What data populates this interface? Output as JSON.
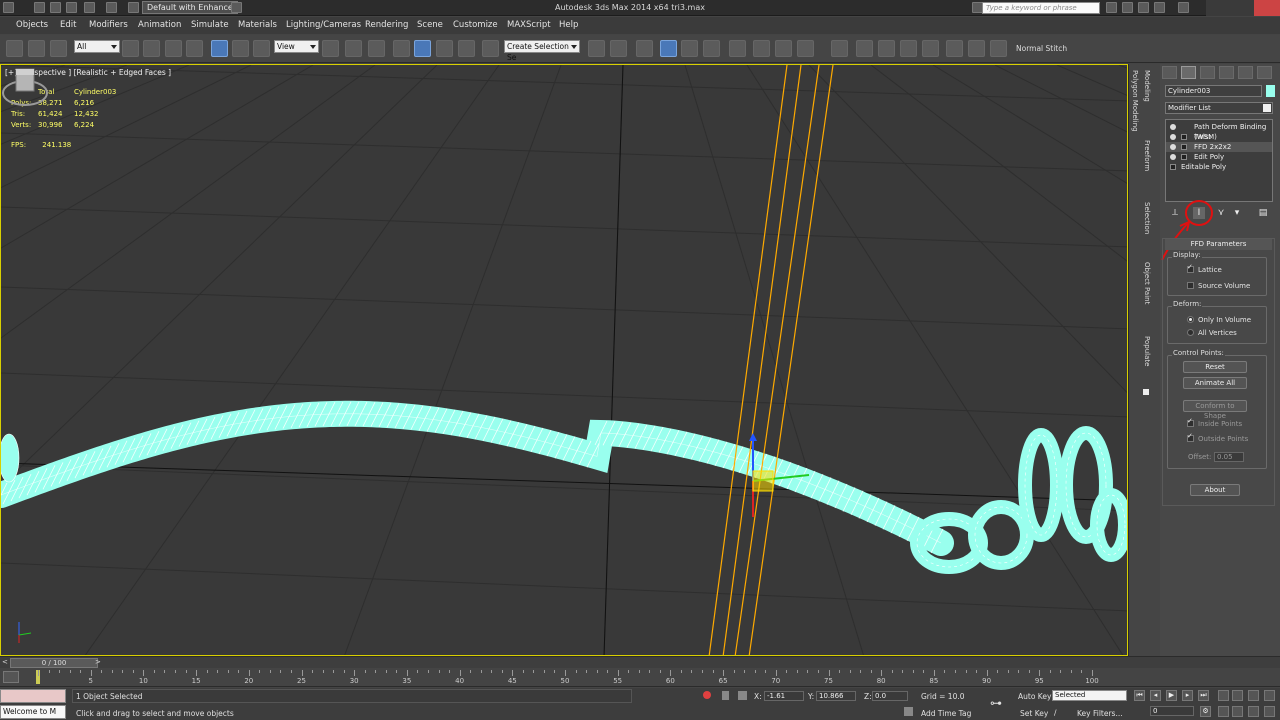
{
  "window": {
    "title": "Autodesk 3ds Max 2014 x64     tri3.max",
    "workspace": "Default with Enhance",
    "search_placeholder": "Type a keyword or phrase"
  },
  "menu": [
    "Objects",
    "Edit",
    "Modifiers",
    "Animation",
    "Simulate",
    "Materials",
    "Lighting/Cameras",
    "Rendering",
    "Scene",
    "Customize",
    "MAXScript",
    "Help"
  ],
  "toolbar": {
    "selection_filter": "All",
    "ref_coord": "View",
    "named_selection": "Create Selection Se",
    "normal_stitch": "Normal Stitch"
  },
  "viewport": {
    "label": "[+] [Perspective ] [Realistic + Edged Faces ]",
    "stats": {
      "col_total": "Total",
      "col_object": "Cylinder003",
      "rows": [
        {
          "label": "Polys:",
          "total": "38,271",
          "object": "6,216"
        },
        {
          "label": "Tris:",
          "total": "61,424",
          "object": "12,432"
        },
        {
          "label": "Verts:",
          "total": "30,996",
          "object": "6,224"
        }
      ],
      "fps_label": "FPS:",
      "fps_value": "241.138"
    },
    "object_color": "#99ffee",
    "gizmo_color": "#ffaa00"
  },
  "ribbon_tabs": [
    "Modeling",
    "Polygon Modeling",
    "Freeform",
    "Selection",
    "Object Paint",
    "Populate"
  ],
  "command_panel": {
    "object_name": "Cylinder003",
    "modifier_list": "Modifier List",
    "stack": [
      {
        "label": "Path Deform Binding (WSM)"
      },
      {
        "label": "Twist"
      },
      {
        "label": "FFD 2x2x2"
      },
      {
        "label": "Edit Poly"
      },
      {
        "label": "Editable Poly"
      }
    ],
    "ffd": {
      "title": "FFD Parameters",
      "display_group": "Display:",
      "lattice": "Lattice",
      "source_volume": "Source Volume",
      "deform_group": "Deform:",
      "only_in_volume": "Only In Volume",
      "all_vertices": "All Vertices",
      "control_group": "Control Points:",
      "reset": "Reset",
      "animate_all": "Animate All",
      "conform": "Conform to Shape",
      "inside_points": "Inside Points",
      "outside_points": "Outside Points",
      "offset_label": "Offset:",
      "offset_value": "0.05",
      "about": "About"
    }
  },
  "timeline": {
    "slider": "0 / 100",
    "ticks": [
      "5",
      "10",
      "15",
      "20",
      "25",
      "30",
      "35",
      "40",
      "45",
      "50",
      "55",
      "60",
      "65",
      "70",
      "75",
      "80",
      "85",
      "90",
      "95",
      "100"
    ]
  },
  "status": {
    "maxscript_text": "Welcome to M",
    "selection": "1 Object Selected",
    "prompt": "Click and drag to select and move objects",
    "x_label": "X:",
    "x_value": "-1.61",
    "y_label": "Y:",
    "y_value": "10.866",
    "z_label": "Z:",
    "z_value": "0.0",
    "grid": "Grid = 10.0",
    "add_time_tag": "Add Time Tag",
    "auto_key": "Auto Key",
    "set_key": "Set Key",
    "key_mode": "Selected",
    "key_filters": "Key Filters...",
    "frame": "0"
  }
}
